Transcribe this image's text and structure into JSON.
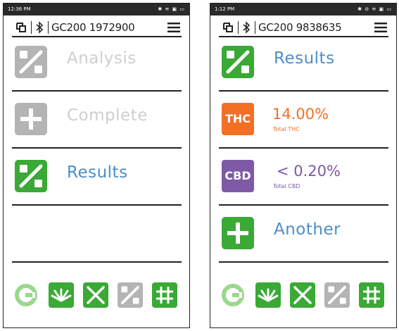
{
  "left_screen": {
    "status_time": "12:36 PM",
    "status_icons": "✱ ≋ ▣ ▭",
    "device_id": "GC200 1972900",
    "menu_items": [
      {
        "label": "Analysis",
        "icon": "percent-icon",
        "state": "disabled"
      },
      {
        "label": "Complete",
        "icon": "plus-icon",
        "state": "disabled"
      },
      {
        "label": "Results",
        "icon": "percent-icon",
        "state": "active"
      }
    ]
  },
  "right_screen": {
    "status_time": "1:12 PM",
    "status_icons": "✱ ⊘ ≋ ▣ ▭",
    "device_id": "GC200 9838635",
    "results_label": "Results",
    "thc": {
      "badge": "THC",
      "value": "14.00%",
      "caption": "Total THC",
      "color": "#f26f26"
    },
    "cbd": {
      "badge": "CBD",
      "value": "< 0.20%",
      "caption": "Total CBD",
      "color": "#7e59a6"
    },
    "another_label": "Another"
  },
  "bottom_nav": [
    "refresh-icon",
    "sun-icon",
    "cross-icon",
    "percent-icon",
    "grid-icon"
  ],
  "colors": {
    "green": "#3aa935",
    "gray": "#b4b4b4",
    "blue_text": "#4a8ec9",
    "disabled_text": "#cfcfcf",
    "light_green": "#9bd88e"
  }
}
